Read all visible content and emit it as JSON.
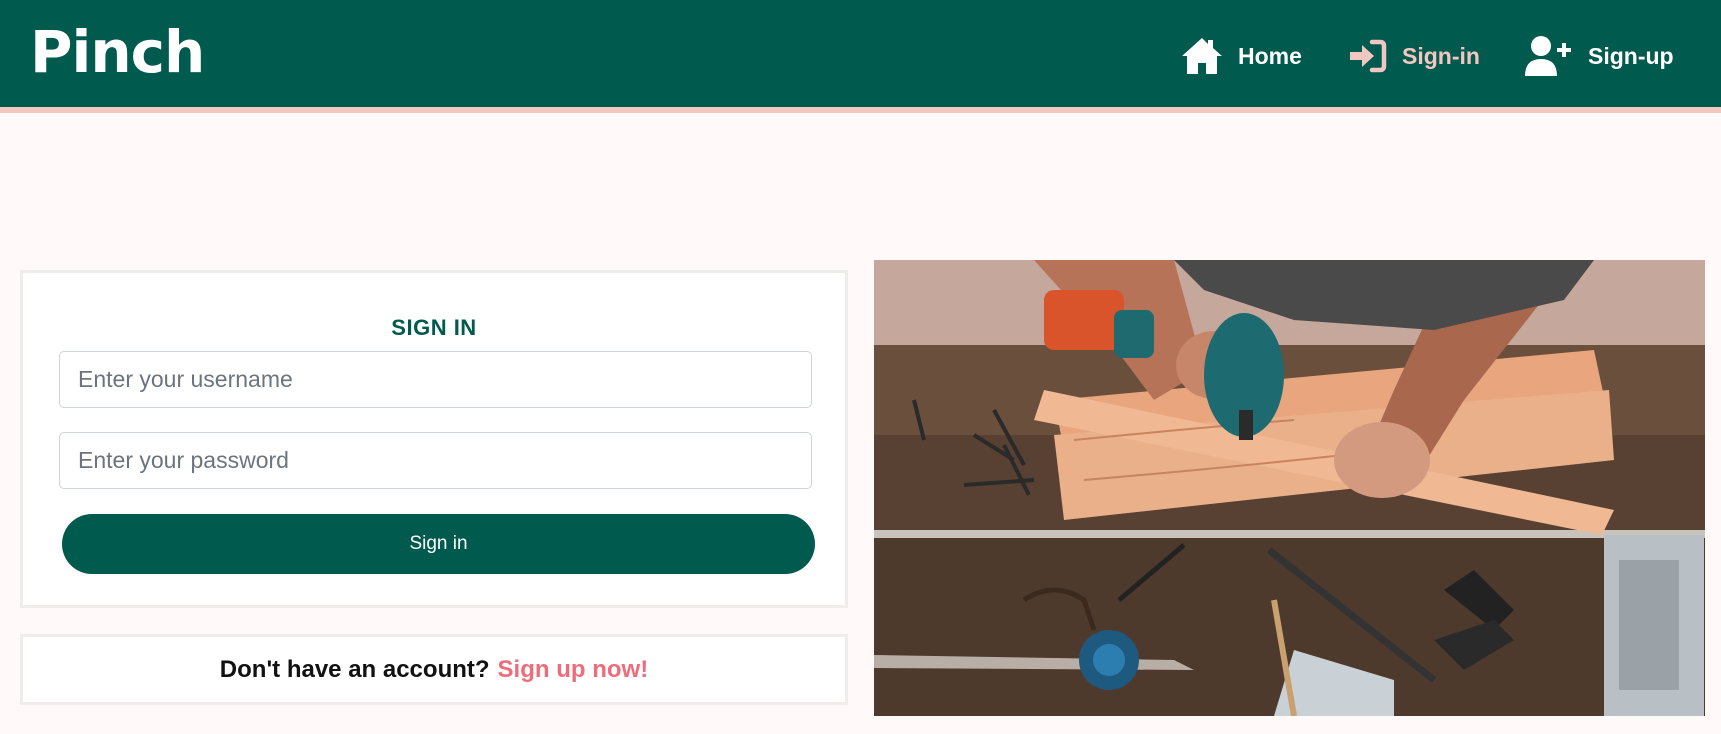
{
  "nav": {
    "brand": "Pinch",
    "items": [
      {
        "label": "Home",
        "icon": "home-icon"
      },
      {
        "label": "Sign-in",
        "icon": "sign-in-icon",
        "active": true
      },
      {
        "label": "Sign-up",
        "icon": "user-plus-icon"
      }
    ]
  },
  "signin": {
    "title": "SIGN IN",
    "username_placeholder": "Enter your username",
    "password_placeholder": "Enter your password",
    "button_label": "Sign in"
  },
  "signup_prompt": {
    "text": "Don't have an account?",
    "link_label": "Sign up now!"
  },
  "colors": {
    "primary": "#005a4e",
    "accent": "#f4c6c1",
    "link": "#ef6c7b",
    "background": "#fffaf9"
  },
  "hero_image": {
    "description_icon": "woodworking-photo"
  }
}
